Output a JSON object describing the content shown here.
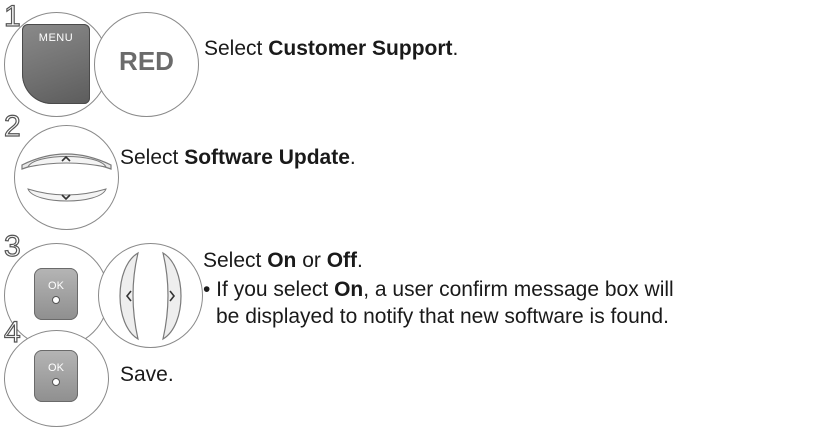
{
  "steps": [
    {
      "number": "1",
      "text_pre": "Select ",
      "text_bold": "Customer Support",
      "text_post": "."
    },
    {
      "number": "2",
      "text_pre": "Select ",
      "text_bold": "Software Update",
      "text_post": "."
    },
    {
      "number": "3",
      "text_pre": "Select ",
      "text_bold": "On",
      "text_mid": " or ",
      "text_bold2": "Off",
      "text_post": ".",
      "bullet_pre": "• If you select ",
      "bullet_bold": "On",
      "bullet_post": ", a user confirm message box will",
      "bullet_line2": "be displayed to notify that new software is found."
    },
    {
      "number": "4",
      "text": "Save."
    }
  ],
  "buttons": {
    "menu_label": "MENU",
    "red_label": "RED",
    "ok_label": "OK"
  },
  "icons": {
    "nav_up": "chevron-up-icon",
    "nav_down": "chevron-down-icon",
    "nav_left": "chevron-left-icon",
    "nav_right": "chevron-right-icon"
  },
  "colors": {
    "button_dark": "#6f6f6f",
    "button_light": "#b5b5b5",
    "red_label": "#6b6b6b"
  }
}
